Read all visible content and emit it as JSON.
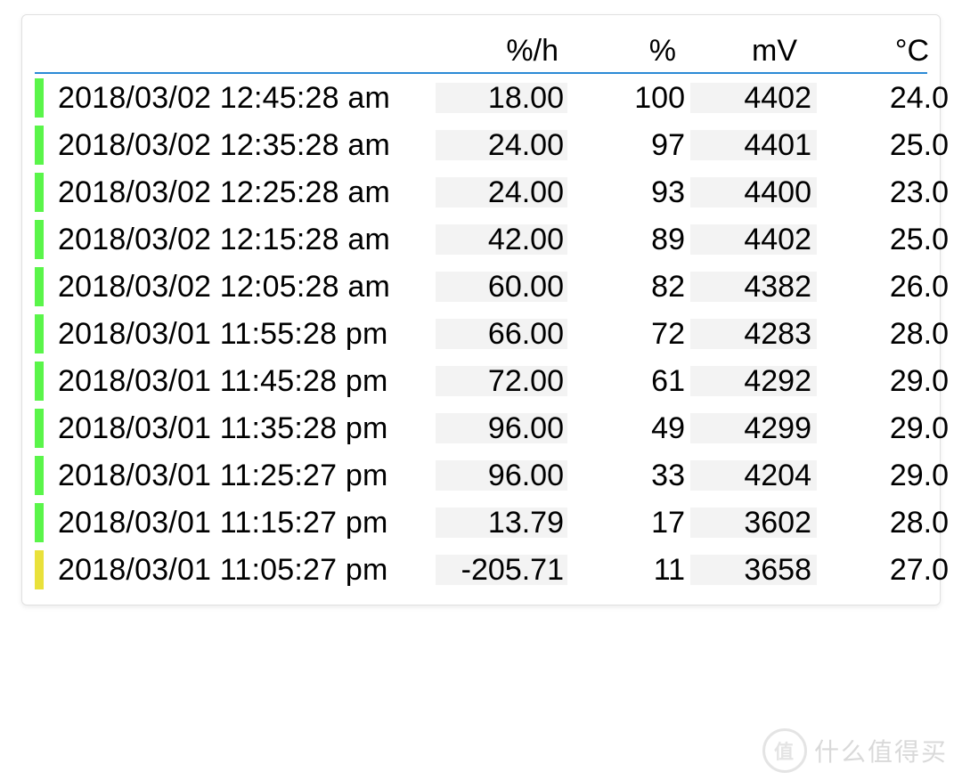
{
  "colors": {
    "status_green": "#5af54a",
    "status_yellow": "#e9e13b",
    "header_underline": "#2b8ad6",
    "shade_bg": "#f3f3f3"
  },
  "watermark": {
    "logo_text": "值",
    "text": "什么值得买"
  },
  "table": {
    "headers": {
      "timestamp": "",
      "rate": "%/h",
      "percent": "%",
      "mv": "mV",
      "temp": "°C"
    },
    "rows": [
      {
        "status": "green",
        "timestamp": "2018/03/02 12:45:28 am",
        "rate": "18.00",
        "percent": "100",
        "mv": "4402",
        "temp": "24.0"
      },
      {
        "status": "green",
        "timestamp": "2018/03/02 12:35:28 am",
        "rate": "24.00",
        "percent": "97",
        "mv": "4401",
        "temp": "25.0"
      },
      {
        "status": "green",
        "timestamp": "2018/03/02 12:25:28 am",
        "rate": "24.00",
        "percent": "93",
        "mv": "4400",
        "temp": "23.0"
      },
      {
        "status": "green",
        "timestamp": "2018/03/02 12:15:28 am",
        "rate": "42.00",
        "percent": "89",
        "mv": "4402",
        "temp": "25.0"
      },
      {
        "status": "green",
        "timestamp": "2018/03/02 12:05:28 am",
        "rate": "60.00",
        "percent": "82",
        "mv": "4382",
        "temp": "26.0"
      },
      {
        "status": "green",
        "timestamp": "2018/03/01 11:55:28 pm",
        "rate": "66.00",
        "percent": "72",
        "mv": "4283",
        "temp": "28.0"
      },
      {
        "status": "green",
        "timestamp": "2018/03/01 11:45:28 pm",
        "rate": "72.00",
        "percent": "61",
        "mv": "4292",
        "temp": "29.0"
      },
      {
        "status": "green",
        "timestamp": "2018/03/01 11:35:28 pm",
        "rate": "96.00",
        "percent": "49",
        "mv": "4299",
        "temp": "29.0"
      },
      {
        "status": "green",
        "timestamp": "2018/03/01 11:25:27 pm",
        "rate": "96.00",
        "percent": "33",
        "mv": "4204",
        "temp": "29.0"
      },
      {
        "status": "green",
        "timestamp": "2018/03/01 11:15:27 pm",
        "rate": "13.79",
        "percent": "17",
        "mv": "3602",
        "temp": "28.0"
      },
      {
        "status": "yellow",
        "timestamp": "2018/03/01 11:05:27 pm",
        "rate": "-205.71",
        "percent": "11",
        "mv": "3658",
        "temp": "27.0"
      }
    ]
  }
}
